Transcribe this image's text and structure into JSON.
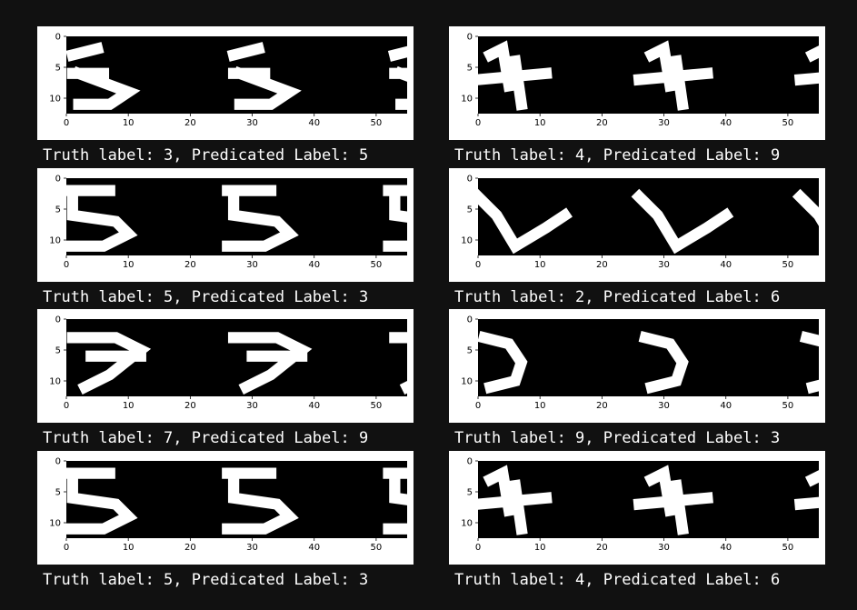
{
  "colors": {
    "background": "#111111",
    "panel": "#ffffff",
    "image_bg": "#000000",
    "caption": "#ffffff"
  },
  "axis": {
    "x_ticks": [
      "0",
      "10",
      "20",
      "30",
      "40",
      "50"
    ],
    "y_ticks": [
      "0",
      "5",
      "10"
    ]
  },
  "cells": [
    {
      "caption": "Truth label: 3, Predicated Label: 5",
      "digits": [
        "3",
        "3",
        "3"
      ]
    },
    {
      "caption": "Truth label: 4, Predicated Label: 9",
      "digits": [
        "4",
        "4",
        "4"
      ]
    },
    {
      "caption": "Truth label: 5, Predicated Label: 3",
      "digits": [
        "5",
        "5",
        "5"
      ]
    },
    {
      "caption": "Truth label: 2, Predicated Label: 6",
      "digits": [
        "2",
        "2",
        "2"
      ]
    },
    {
      "caption": "Truth label: 7, Predicated Label: 9",
      "digits": [
        "7",
        "7",
        "7"
      ]
    },
    {
      "caption": "Truth label: 9, Predicated Label: 3",
      "digits": [
        "9",
        "9",
        "9"
      ]
    },
    {
      "caption": "Truth label: 5, Predicated Label: 3",
      "digits": [
        "5",
        "5",
        "5"
      ]
    },
    {
      "caption": "Truth label: 4, Predicated Label: 6",
      "digits": [
        "4",
        "4",
        "4"
      ]
    }
  ]
}
